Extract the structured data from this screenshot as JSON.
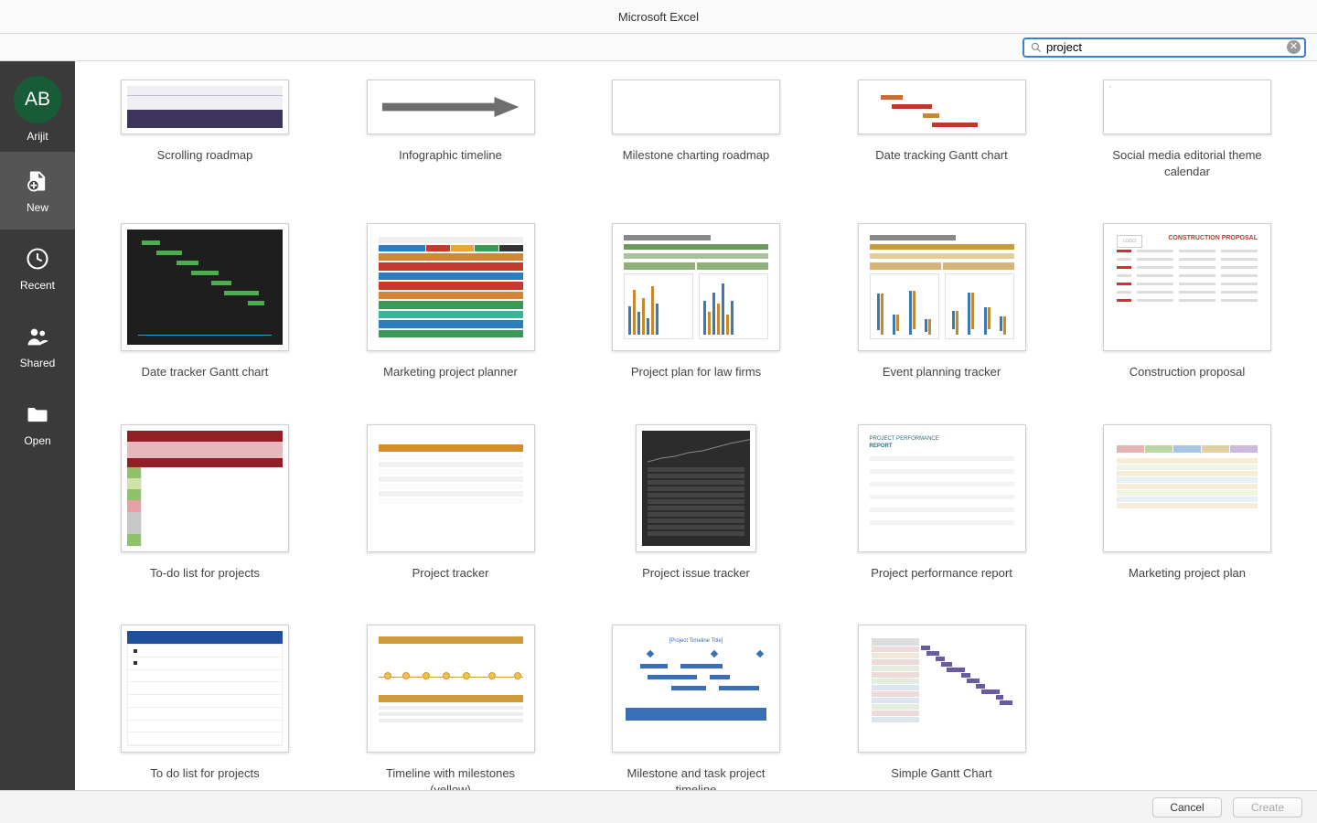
{
  "window": {
    "title": "Microsoft Excel"
  },
  "search": {
    "value": "project",
    "placeholder": "Search"
  },
  "user": {
    "initials": "AB",
    "name": "Arijit"
  },
  "sidebar": {
    "items": [
      {
        "id": "new",
        "label": "New",
        "selected": true
      },
      {
        "id": "recent",
        "label": "Recent",
        "selected": false
      },
      {
        "id": "shared",
        "label": "Shared",
        "selected": false
      },
      {
        "id": "open",
        "label": "Open",
        "selected": false
      }
    ]
  },
  "templates": [
    {
      "id": "scrolling-roadmap",
      "label": "Scrolling roadmap"
    },
    {
      "id": "infographic-timeline",
      "label": "Infographic timeline"
    },
    {
      "id": "milestone-charting-roadmap",
      "label": "Milestone charting roadmap"
    },
    {
      "id": "date-tracking-gantt-chart",
      "label": "Date tracking Gantt chart"
    },
    {
      "id": "social-media-editorial-theme-calendar",
      "label": "Social media editorial theme calendar"
    },
    {
      "id": "date-tracker-gantt-chart",
      "label": "Date tracker Gantt chart"
    },
    {
      "id": "marketing-project-planner",
      "label": "Marketing project planner"
    },
    {
      "id": "project-plan-for-law-firms",
      "label": "Project plan for law firms"
    },
    {
      "id": "event-planning-tracker",
      "label": "Event planning tracker"
    },
    {
      "id": "construction-proposal",
      "label": "Construction proposal"
    },
    {
      "id": "to-do-list-for-projects-red",
      "label": "To-do list for projects"
    },
    {
      "id": "project-tracker",
      "label": "Project tracker"
    },
    {
      "id": "project-issue-tracker",
      "label": "Project issue tracker"
    },
    {
      "id": "project-performance-report",
      "label": "Project performance report"
    },
    {
      "id": "marketing-project-plan",
      "label": "Marketing project plan"
    },
    {
      "id": "to-do-list-for-projects-blue",
      "label": "To do list for projects"
    },
    {
      "id": "timeline-with-milestones-yellow",
      "label": "Timeline with milestones (yellow)"
    },
    {
      "id": "milestone-and-task-project-timeline",
      "label": "Milestone and task project timeline"
    },
    {
      "id": "simple-gantt-chart",
      "label": "Simple Gantt Chart"
    }
  ],
  "footer": {
    "cancel_label": "Cancel",
    "create_label": "Create",
    "create_enabled": false
  }
}
